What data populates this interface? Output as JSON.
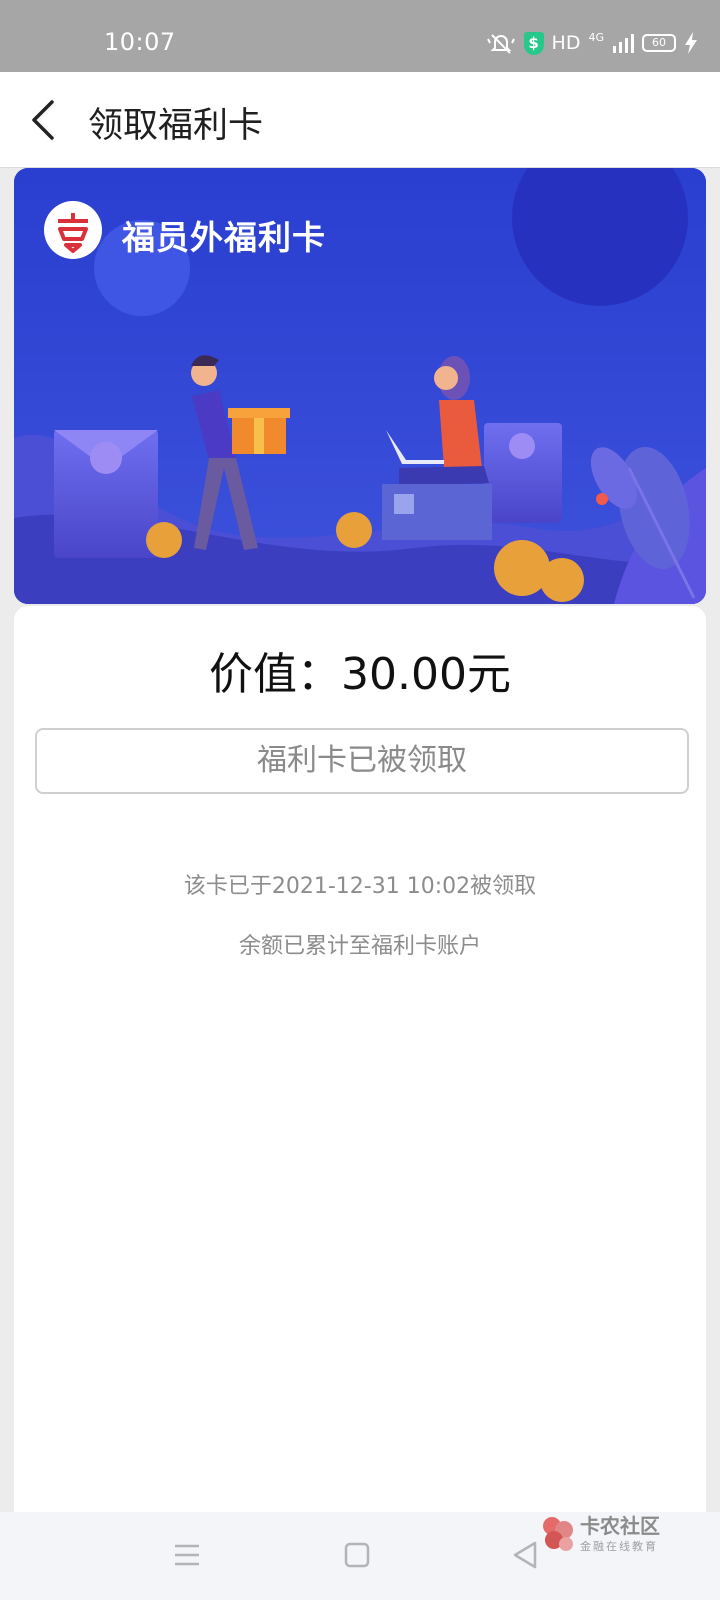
{
  "status_bar": {
    "time": "10:07",
    "hd": "HD",
    "network": "4G",
    "battery": "60",
    "icons": [
      "mute-bell-icon",
      "security-shield-icon",
      "signal-icon",
      "battery-icon",
      "charging-bolt-icon"
    ]
  },
  "header": {
    "title": "领取福利卡",
    "back_icon": "chevron-left-icon"
  },
  "card": {
    "brand_name": "福员外福利卡",
    "logo_icon": "brand-logo-icon",
    "background": "#2c47d4",
    "illustration": "man-holding-gift-and-woman-with-laptop"
  },
  "detail": {
    "value_text": "价值：30.00元",
    "button_label": "福利卡已被领取",
    "claimed_note": "该卡已于2021-12-31 10:02被领取",
    "balance_note": "余额已累计至福利卡账户"
  },
  "nav_bar": {
    "icons": [
      "menu-icon",
      "home-square-icon",
      "back-triangle-icon"
    ]
  },
  "watermark": {
    "title": "卡农社区",
    "subtitle": "金融在线教育"
  }
}
